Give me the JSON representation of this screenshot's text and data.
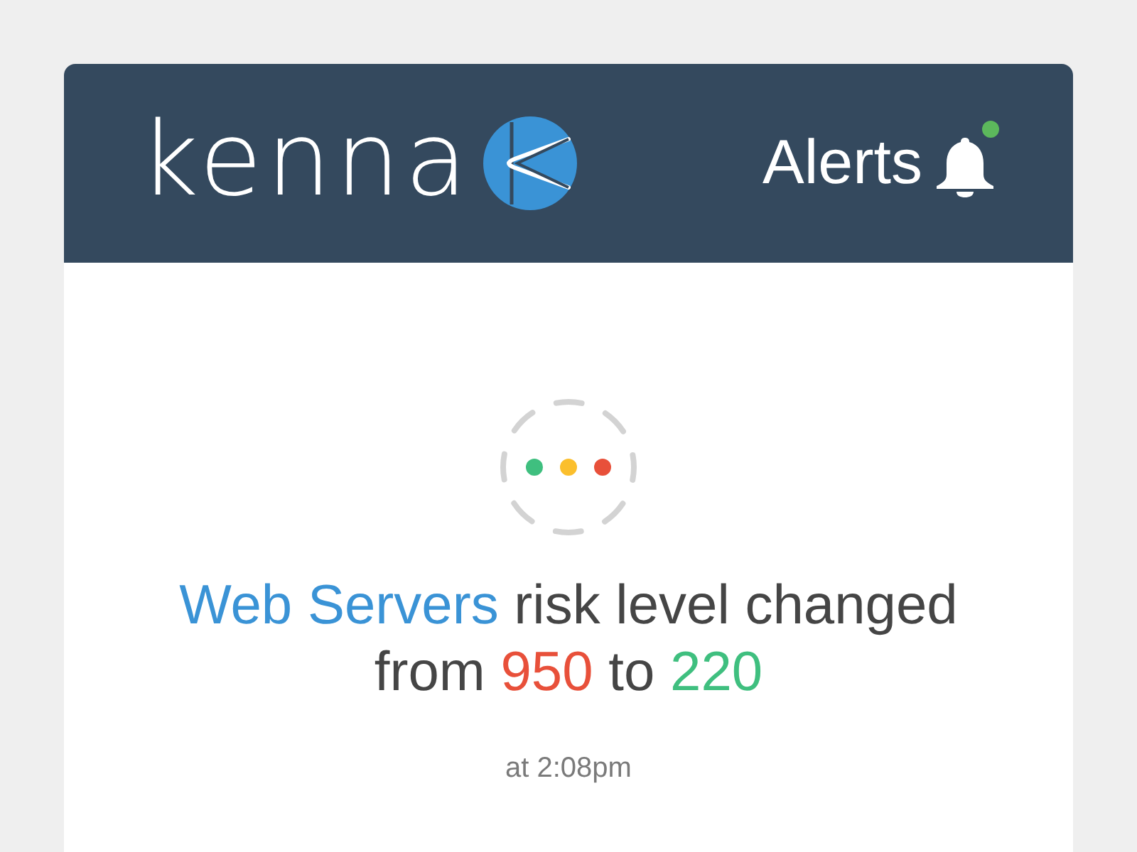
{
  "header": {
    "logo": {
      "text": "kenna"
    },
    "alerts": {
      "label": "Alerts",
      "unread": true
    }
  },
  "loader": {
    "dots": [
      {
        "color": "#3fbf7f"
      },
      {
        "color": "#fbbf2d"
      },
      {
        "color": "#e8503a"
      }
    ]
  },
  "notification": {
    "message": [
      {
        "kind": "subject",
        "text": "Web Servers"
      },
      {
        "kind": "plain",
        "text": " risk level changed from "
      },
      {
        "kind": "old_value",
        "text": "950"
      },
      {
        "kind": "plain",
        "text": " to "
      },
      {
        "kind": "new_value",
        "text": "220"
      }
    ],
    "time": "at 2:08pm"
  }
}
